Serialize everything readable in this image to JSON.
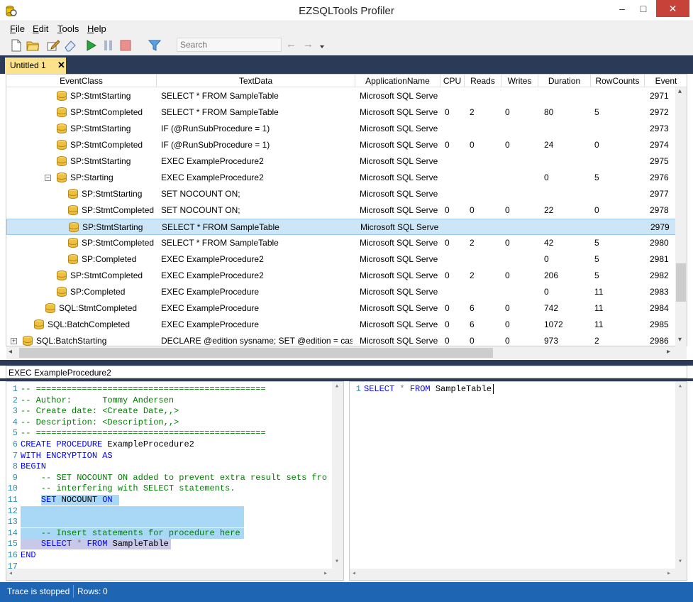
{
  "window": {
    "title": "EZSQLTools Profiler",
    "minimize": "–",
    "maximize": "□",
    "close": "✕"
  },
  "menu": [
    {
      "key": "F",
      "rest": "ile"
    },
    {
      "key": "E",
      "rest": "dit"
    },
    {
      "key": "T",
      "rest": "ools"
    },
    {
      "key": "H",
      "rest": "elp"
    }
  ],
  "toolbar": {
    "search_placeholder": "Search",
    "back": "←",
    "forward": "→"
  },
  "tabs": [
    {
      "label": "Untitled 1",
      "close": "✕"
    }
  ],
  "columns": [
    "EventClass",
    "TextData",
    "ApplicationName",
    "CPU",
    "Reads",
    "Writes",
    "Duration",
    "RowCounts",
    "Event"
  ],
  "rows": [
    {
      "eventclass": "SP:StmtStarting",
      "textdata": "SELECT * FROM SampleTable",
      "app": "Microsoft SQL Serve",
      "cpu": "",
      "reads": "",
      "writes": "",
      "duration": "",
      "rowcounts": "",
      "event": "2971"
    },
    {
      "eventclass": "SP:StmtCompleted",
      "textdata": "SELECT * FROM SampleTable",
      "app": "Microsoft SQL Serve",
      "cpu": "0",
      "reads": "2",
      "writes": "0",
      "duration": "80",
      "rowcounts": "5",
      "event": "2972"
    },
    {
      "eventclass": "SP:StmtStarting",
      "textdata": "IF (@RunSubProcedure = 1)",
      "app": "Microsoft SQL Serve",
      "cpu": "",
      "reads": "",
      "writes": "",
      "duration": "",
      "rowcounts": "",
      "event": "2973"
    },
    {
      "eventclass": "SP:StmtCompleted",
      "textdata": "IF (@RunSubProcedure = 1)",
      "app": "Microsoft SQL Serve",
      "cpu": "0",
      "reads": "0",
      "writes": "0",
      "duration": "24",
      "rowcounts": "0",
      "event": "2974"
    },
    {
      "eventclass": "SP:StmtStarting",
      "textdata": "EXEC ExampleProcedure2",
      "app": "Microsoft SQL Serve",
      "cpu": "",
      "reads": "",
      "writes": "",
      "duration": "",
      "rowcounts": "",
      "event": "2975"
    },
    {
      "eventclass": "SP:Starting",
      "textdata": "EXEC ExampleProcedure2",
      "app": "Microsoft SQL Serve",
      "cpu": "",
      "reads": "",
      "writes": "",
      "duration": "0",
      "rowcounts": "5",
      "event": "2976"
    },
    {
      "eventclass": "SP:StmtStarting",
      "textdata": "SET NOCOUNT ON;",
      "app": "Microsoft SQL Serve",
      "cpu": "",
      "reads": "",
      "writes": "",
      "duration": "",
      "rowcounts": "",
      "event": "2977"
    },
    {
      "eventclass": "SP:StmtCompleted",
      "textdata": "SET NOCOUNT ON;",
      "app": "Microsoft SQL Serve",
      "cpu": "0",
      "reads": "0",
      "writes": "0",
      "duration": "22",
      "rowcounts": "0",
      "event": "2978"
    },
    {
      "eventclass": "SP:StmtStarting",
      "textdata": "SELECT * FROM SampleTable",
      "app": "Microsoft SQL Serve",
      "cpu": "",
      "reads": "",
      "writes": "",
      "duration": "",
      "rowcounts": "",
      "event": "2979"
    },
    {
      "eventclass": "SP:StmtCompleted",
      "textdata": "SELECT * FROM SampleTable",
      "app": "Microsoft SQL Serve",
      "cpu": "0",
      "reads": "2",
      "writes": "0",
      "duration": "42",
      "rowcounts": "5",
      "event": "2980"
    },
    {
      "eventclass": "SP:Completed",
      "textdata": "EXEC ExampleProcedure2",
      "app": "Microsoft SQL Serve",
      "cpu": "",
      "reads": "",
      "writes": "",
      "duration": "0",
      "rowcounts": "5",
      "event": "2981"
    },
    {
      "eventclass": "SP:StmtCompleted",
      "textdata": "EXEC ExampleProcedure2",
      "app": "Microsoft SQL Serve",
      "cpu": "0",
      "reads": "2",
      "writes": "0",
      "duration": "206",
      "rowcounts": "5",
      "event": "2982"
    },
    {
      "eventclass": "SP:Completed",
      "textdata": "EXEC ExampleProcedure",
      "app": "Microsoft SQL Serve",
      "cpu": "",
      "reads": "",
      "writes": "",
      "duration": "0",
      "rowcounts": "11",
      "event": "2983"
    },
    {
      "eventclass": "SQL:StmtCompleted",
      "textdata": "EXEC ExampleProcedure",
      "app": "Microsoft SQL Serve",
      "cpu": "0",
      "reads": "6",
      "writes": "0",
      "duration": "742",
      "rowcounts": "11",
      "event": "2984"
    },
    {
      "eventclass": "SQL:BatchCompleted",
      "textdata": "EXEC ExampleProcedure",
      "app": "Microsoft SQL Serve",
      "cpu": "0",
      "reads": "6",
      "writes": "0",
      "duration": "1072",
      "rowcounts": "11",
      "event": "2985"
    },
    {
      "eventclass": "SQL:BatchStarting",
      "textdata": "DECLARE @edition sysname; SET @edition = cast(S",
      "app": "Microsoft SQL Serve",
      "cpu": "0",
      "reads": "0",
      "writes": "0",
      "duration": "973",
      "rowcounts": "2",
      "event": "2986"
    }
  ],
  "expanders": {
    "collapse": "−",
    "expand": "+"
  },
  "scroll_arrows": {
    "up": "▴",
    "down": "▾",
    "left": "◂",
    "right": "▸"
  },
  "selected_text": "EXEC ExampleProcedure2",
  "left_code": [
    {
      "n": "1",
      "text": "-- ============================================="
    },
    {
      "n": "2",
      "text": "-- Author:      Tommy Andersen"
    },
    {
      "n": "3",
      "text": "-- Create date: <Create Date,,>"
    },
    {
      "n": "4",
      "text": "-- Description: <Description,,>"
    },
    {
      "n": "5",
      "text": "-- ============================================="
    },
    {
      "n": "6",
      "text": "CREATE PROCEDURE ExampleProcedure2"
    },
    {
      "n": "7",
      "text": "WITH ENCRYPTION AS"
    },
    {
      "n": "8",
      "text": "BEGIN"
    },
    {
      "n": "9",
      "text": "    -- SET NOCOUNT ON added to prevent extra result sets fro"
    },
    {
      "n": "10",
      "text": "    -- interfering with SELECT statements."
    },
    {
      "n": "11",
      "text": "    SET NOCOUNT ON "
    },
    {
      "n": "12",
      "text": ""
    },
    {
      "n": "13",
      "text": ""
    },
    {
      "n": "14",
      "text": "    -- Insert statements for procedure here"
    },
    {
      "n": "15",
      "text": "    SELECT * FROM SampleTable"
    },
    {
      "n": "16",
      "text": "END"
    },
    {
      "n": "17",
      "text": ""
    }
  ],
  "right_code": [
    {
      "n": "1",
      "text": "SELECT * FROM SampleTable"
    }
  ],
  "status": {
    "trace": "Trace is stopped",
    "rows_label": "Rows:",
    "rows_value": "0"
  },
  "colors": {
    "accent_dark": "#2b3b57",
    "status_blue": "#1e66b3",
    "tab_active": "#fce28a",
    "selection": "#cde6f7"
  }
}
